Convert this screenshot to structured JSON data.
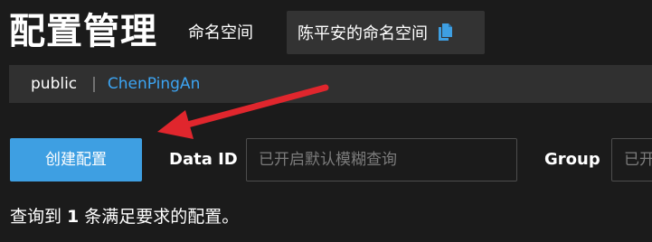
{
  "header": {
    "title": "配置管理",
    "namespace_label": "命名空间",
    "namespace_value": "陈平安的命名空间",
    "copy_icon": "copy-icon"
  },
  "namespace_tabs": {
    "items": [
      {
        "label": "public",
        "active": false
      },
      {
        "label": "ChenPingAn",
        "active": true
      }
    ],
    "separator": "|"
  },
  "toolbar": {
    "create_button": "创建配置",
    "data_id_label": "Data ID",
    "data_id_placeholder": "已开启默认模糊查询",
    "group_label": "Group",
    "group_placeholder": "已开启默认模糊查询"
  },
  "result": {
    "prefix": "查询到",
    "count": "1",
    "suffix": "条满足要求的配置。"
  },
  "colors": {
    "background": "#1b1b1b",
    "accent": "#3e9fe2",
    "active_tab": "#3ca4f2",
    "arrow": "#e0262d"
  }
}
